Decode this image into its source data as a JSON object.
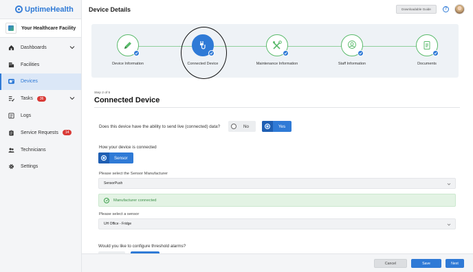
{
  "app": {
    "name": "UptimeHealth",
    "brand_color": "#2f7ad6"
  },
  "facility": {
    "name": "Your Healthcare Facility"
  },
  "sidebar": {
    "items": [
      {
        "label": "Dashboards",
        "icon": "home-icon"
      },
      {
        "label": "Facilities",
        "icon": "building-icon"
      },
      {
        "label": "Devices",
        "icon": "device-icon",
        "active": true
      },
      {
        "label": "Tasks",
        "icon": "tasks-icon",
        "badge": "36"
      },
      {
        "label": "Logs",
        "icon": "log-icon"
      },
      {
        "label": "Service Requests",
        "icon": "clipboard-icon",
        "badge": "14"
      },
      {
        "label": "Technicians",
        "icon": "people-icon"
      },
      {
        "label": "Settings",
        "icon": "gear-icon"
      }
    ]
  },
  "header": {
    "title": "Device Details",
    "guide_label": "Downloadable Guide",
    "help_label": "?"
  },
  "stepper": {
    "steps": [
      {
        "label": "Device Information",
        "icon": "pencil-icon"
      },
      {
        "label": "Connected Device",
        "icon": "plug-icon",
        "active": true
      },
      {
        "label": "Maintenance Information",
        "icon": "tools-icon"
      },
      {
        "label": "Staff Information",
        "icon": "person-icon"
      },
      {
        "label": "Documents",
        "icon": "document-icon"
      }
    ]
  },
  "form": {
    "step_count": "Step 2 of 5",
    "section_title": "Connected Device",
    "live_question": "Does this device have the ability to send live (connected) data?",
    "no_label": "No",
    "yes_label": "Yes",
    "connect_question": "How your device is connected",
    "sensor_label": "Sensor",
    "manufacturer_label": "Please select the Sensor Manufacturer",
    "manufacturer_value": "SensorPush",
    "connected_message": "Manufacturer connected",
    "sensor_select_label": "Please select a sensor",
    "sensor_value": "UH Office - Fridge",
    "threshold_question": "Would you like to configure threshold alarms?"
  },
  "footer": {
    "cancel_label": "Cancel",
    "save_label": "Save",
    "next_label": "Next"
  }
}
